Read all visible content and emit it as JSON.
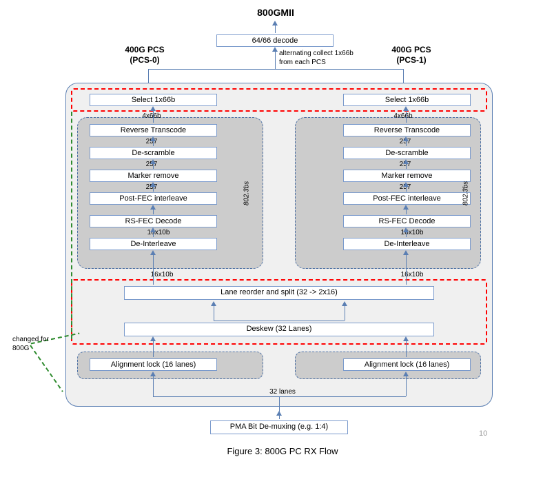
{
  "title": "800GMII",
  "decode_box": "64/66 decode",
  "pcs0_title1": "400G PCS",
  "pcs0_title2": "(PCS-0)",
  "pcs1_title1": "400G PCS",
  "pcs1_title2": "(PCS-1)",
  "collect_note1": "alternating collect 1x66b",
  "collect_note2": "from each PCS",
  "blocks": {
    "select": "Select 1x66b",
    "rev_transcode": "Reverse Transcode",
    "descramble": "De-scramble",
    "marker_remove": "Marker remove",
    "postfec": "Post-FEC interleave",
    "rsfec": "RS-FEC Decode",
    "deinterleave": "De-Interleave",
    "lane_reorder": "Lane reorder and split (32 -> 2x16)",
    "deskew": "Deskew (32 Lanes)",
    "align_lock": "Alignment lock (16 lanes)",
    "pma": "PMA Bit De-muxing (e.g. 1:4)"
  },
  "labels": {
    "l4x66b": "4x66b",
    "l257": "257",
    "l16x10b": "16x10b",
    "l32lanes": "32 lanes",
    "l8023bs": "802.3bs"
  },
  "changed_note1": "changed for",
  "changed_note2": "800G",
  "caption": "Figure 3: 800G PC RX Flow",
  "pagenum": "10"
}
